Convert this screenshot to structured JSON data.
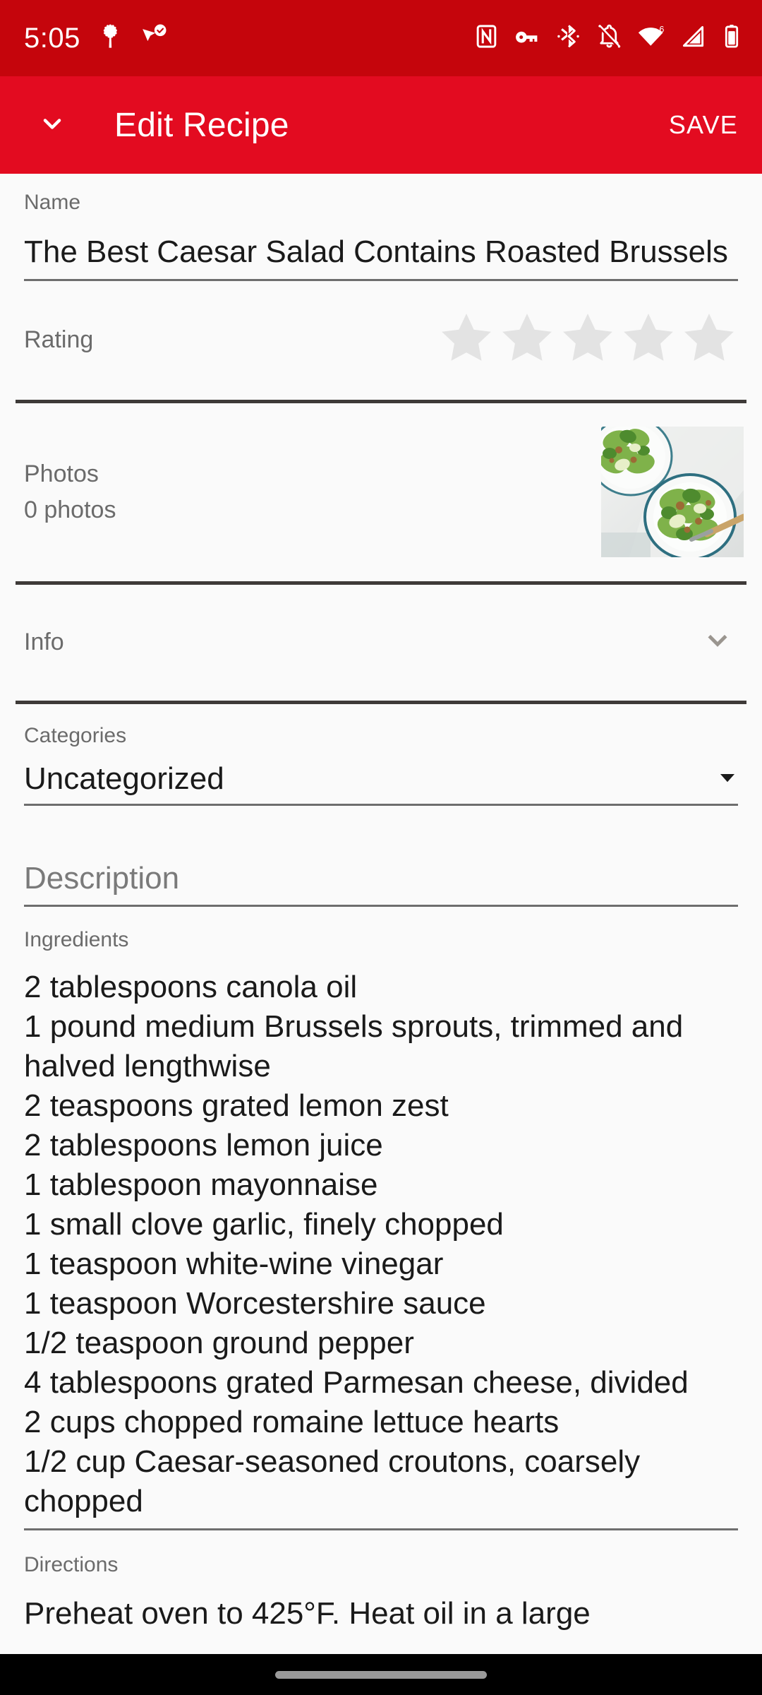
{
  "status_bar": {
    "time": "5:05",
    "background": "#C5050C",
    "left_icons": [
      "tree-icon",
      "location-check-icon"
    ],
    "right_icons": [
      "nfc-icon",
      "vpn-key-icon",
      "bluetooth-icon",
      "notifications-off-icon",
      "wifi-icon",
      "cellular-signal-icon",
      "battery-icon"
    ],
    "wifi_generation": "6"
  },
  "app_bar": {
    "background": "#E30B20",
    "back_icon": "chevron-down-icon",
    "title": "Edit Recipe",
    "save_label": "SAVE"
  },
  "form": {
    "name": {
      "label": "Name",
      "value": "The Best Caesar Salad Contains Roasted Brussels"
    },
    "rating": {
      "label": "Rating",
      "stars_total": 5,
      "stars_filled": 0,
      "empty_star_color": "#E3E3E3"
    },
    "photos": {
      "label": "Photos",
      "count_text": "0 photos",
      "thumbnail": "caesar-salad-photo"
    },
    "info": {
      "label": "Info",
      "expander_icon": "chevron-down-icon",
      "expanded": false
    },
    "categories": {
      "label": "Categories",
      "selected": "Uncategorized",
      "caret_icon": "dropdown-caret-icon"
    },
    "description": {
      "placeholder": "Description",
      "value": ""
    },
    "ingredients": {
      "label": "Ingredients",
      "lines": [
        "2 tablespoons canola oil",
        "1 pound medium Brussels sprouts, trimmed and halved lengthwise",
        "2 teaspoons grated lemon zest",
        "2 tablespoons lemon juice",
        "1 tablespoon mayonnaise",
        "1 small clove garlic, finely chopped",
        "1 teaspoon white-wine vinegar",
        "1 teaspoon Worcestershire sauce",
        "1/2 teaspoon ground pepper",
        "4 tablespoons grated Parmesan cheese, divided",
        "2 cups chopped romaine lettuce hearts",
        "1/2 cup Caesar-seasoned croutons, coarsely chopped"
      ]
    },
    "directions": {
      "label": "Directions",
      "text": "Preheat oven to 425°F. Heat oil in a large"
    }
  },
  "nav_bar": {
    "gesture_pill": "home-gesture-pill"
  }
}
